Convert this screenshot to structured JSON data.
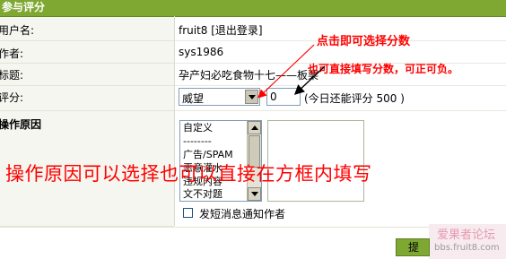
{
  "header": {
    "title": "参与评分"
  },
  "rows": {
    "username": {
      "label": "用户名:",
      "value": "fruit8 [退出登录]"
    },
    "author": {
      "label": "作者:",
      "value": "sys1986"
    },
    "subject": {
      "label": "标题:",
      "value": "孕产妇必吃食物十七——板栗"
    },
    "score": {
      "label": "评分:",
      "selected": "威望",
      "input_value": "0",
      "note": "(今日还能评分 500 )"
    },
    "reason": {
      "label": "操作原因",
      "options": [
        "自定义",
        "--------",
        "广告/SPAM",
        "恶意灌水",
        "违规内容",
        "文不对题"
      ],
      "notify_label": "发短消息通知作者"
    }
  },
  "submit_label": "提",
  "annotations": {
    "click_select": "点击即可选择分数",
    "direct_input": "也可直接填写分数，可正可负。",
    "reason_hint": "操作原因可以选择也可以直接在方框内填写"
  },
  "watermark": {
    "title": "爱果者论坛",
    "url": "bbs.fruit8.com"
  },
  "colors": {
    "accent": "#7fa832",
    "annotation": "#ff0000"
  }
}
